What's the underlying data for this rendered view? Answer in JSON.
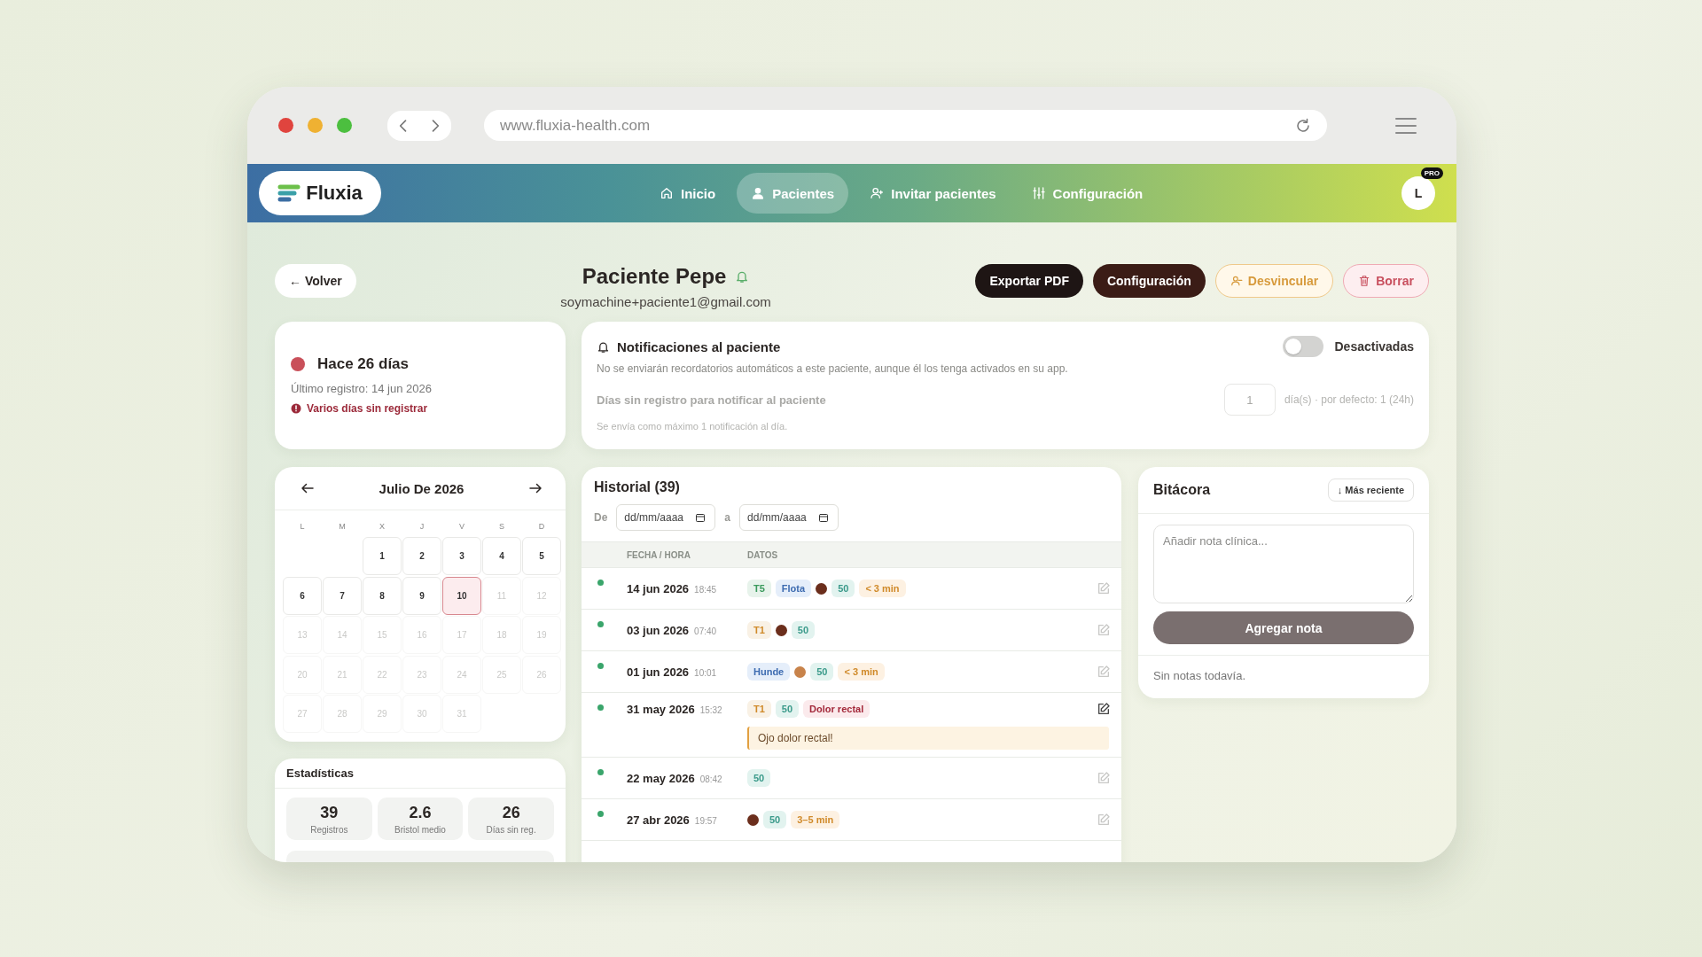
{
  "browser": {
    "url": "www.fluxia-health.com"
  },
  "nav": {
    "logo": "Fluxia",
    "items": [
      {
        "label": "Inicio",
        "selected": false
      },
      {
        "label": "Pacientes",
        "selected": true
      },
      {
        "label": "Invitar pacientes",
        "selected": false
      },
      {
        "label": "Configuración",
        "selected": false
      }
    ],
    "avatar": "L",
    "badge": "PRO"
  },
  "patient": {
    "back": "← Volver",
    "name": "Paciente Pepe",
    "email": "soymachine+paciente1@gmail.com",
    "actions": [
      {
        "label": "Exportar PDF",
        "kind": "primary"
      },
      {
        "label": "Configuración",
        "kind": "secondary"
      },
      {
        "label": "Desvincular",
        "kind": "warning"
      },
      {
        "label": "Borrar",
        "kind": "danger"
      }
    ]
  },
  "status": {
    "title": "Hace 26 días",
    "color": "#c9505a",
    "last": "Último registro: 14 jun 2026",
    "alert": "Varios días sin registrar"
  },
  "calendar": {
    "title": "Julio De 2026",
    "weekdays": [
      "L",
      "M",
      "X",
      "J",
      "V",
      "S",
      "D"
    ],
    "days": [
      {
        "kind": "blank"
      },
      {
        "kind": "blank"
      },
      {
        "kind": "day",
        "label": "1",
        "disabled": false,
        "selected": false
      },
      {
        "kind": "day",
        "label": "2",
        "disabled": false,
        "selected": false
      },
      {
        "kind": "day",
        "label": "3",
        "disabled": false,
        "selected": false
      },
      {
        "kind": "day",
        "label": "4",
        "disabled": false,
        "selected": false
      },
      {
        "kind": "day",
        "label": "5",
        "disabled": false,
        "selected": false
      },
      {
        "kind": "day",
        "label": "6",
        "disabled": false,
        "selected": false
      },
      {
        "kind": "day",
        "label": "7",
        "disabled": false,
        "selected": false
      },
      {
        "kind": "day",
        "label": "8",
        "disabled": false,
        "selected": false
      },
      {
        "kind": "day",
        "label": "9",
        "disabled": false,
        "selected": false
      },
      {
        "kind": "day",
        "label": "10",
        "disabled": false,
        "selected": true
      },
      {
        "kind": "day",
        "label": "11",
        "disabled": true,
        "selected": false
      },
      {
        "kind": "day",
        "label": "12",
        "disabled": true,
        "selected": false
      },
      {
        "kind": "day",
        "label": "13",
        "disabled": true,
        "selected": false
      },
      {
        "kind": "day",
        "label": "14",
        "disabled": true,
        "selected": false
      },
      {
        "kind": "day",
        "label": "15",
        "disabled": true,
        "selected": false
      },
      {
        "kind": "day",
        "label": "16",
        "disabled": true,
        "selected": false
      },
      {
        "kind": "day",
        "label": "17",
        "disabled": true,
        "selected": false
      },
      {
        "kind": "day",
        "label": "18",
        "disabled": true,
        "selected": false
      },
      {
        "kind": "day",
        "label": "19",
        "disabled": true,
        "selected": false
      },
      {
        "kind": "day",
        "label": "20",
        "disabled": true,
        "selected": false
      },
      {
        "kind": "day",
        "label": "21",
        "disabled": true,
        "selected": false
      },
      {
        "kind": "day",
        "label": "22",
        "disabled": true,
        "selected": false
      },
      {
        "kind": "day",
        "label": "23",
        "disabled": true,
        "selected": false
      },
      {
        "kind": "day",
        "label": "24",
        "disabled": true,
        "selected": false
      },
      {
        "kind": "day",
        "label": "25",
        "disabled": true,
        "selected": false
      },
      {
        "kind": "day",
        "label": "26",
        "disabled": true,
        "selected": false
      },
      {
        "kind": "day",
        "label": "27",
        "disabled": true,
        "selected": false
      },
      {
        "kind": "day",
        "label": "28",
        "disabled": true,
        "selected": false
      },
      {
        "kind": "day",
        "label": "29",
        "disabled": true,
        "selected": false
      },
      {
        "kind": "day",
        "label": "30",
        "disabled": true,
        "selected": false
      },
      {
        "kind": "day",
        "label": "31",
        "disabled": true,
        "selected": false
      }
    ]
  },
  "stats": {
    "title": "Estadísticas",
    "items": [
      {
        "value": "39",
        "label": "Registros"
      },
      {
        "value": "2.6",
        "label": "Bristol medio"
      },
      {
        "value": "26",
        "label": "Días sin reg."
      }
    ]
  },
  "notifications": {
    "title": "Notificaciones al paciente",
    "toggle_label": "Desactivadas",
    "on": false,
    "description": "No se enviarán recordatorios automáticos a este paciente, aunque él los tenga activados en su app.",
    "disabled": true,
    "setting_label": "Días sin registro para notificar al paciente",
    "days_value": "1",
    "unit_hint": "día(s) · por defecto: 1 (24h)",
    "footnote": "Se envía como máximo 1 notificación al día."
  },
  "history": {
    "title": "Historial (39)",
    "from_label": "De",
    "from_placeholder": "dd/mm/aaaa",
    "to_label": "a",
    "to_placeholder": "dd/mm/aaaa",
    "columns": [
      "FECHA / HORA",
      "DATOS"
    ],
    "rows": [
      {
        "date": "14 jun 2026",
        "time": "18:45",
        "edit_active": false,
        "tags": [
          {
            "kind": "type",
            "text": "T5",
            "color": "#3a9a5c"
          },
          {
            "kind": "float",
            "text": "Flota"
          },
          {
            "kind": "dot",
            "color": "#6b2e1c"
          },
          {
            "kind": "number",
            "text": "50"
          },
          {
            "kind": "time",
            "text": "< 3 min"
          }
        ]
      },
      {
        "date": "03 jun 2026",
        "time": "07:40",
        "edit_active": false,
        "tags": [
          {
            "kind": "type",
            "text": "T1",
            "color": "#d08a2a"
          },
          {
            "kind": "dot",
            "color": "#6b2e1c"
          },
          {
            "kind": "number",
            "text": "50"
          }
        ]
      },
      {
        "date": "01 jun 2026",
        "time": "10:01",
        "edit_active": false,
        "tags": [
          {
            "kind": "float",
            "text": "Hunde"
          },
          {
            "kind": "dot",
            "color": "#c8834a"
          },
          {
            "kind": "number",
            "text": "50"
          },
          {
            "kind": "time",
            "text": "< 3 min"
          }
        ]
      },
      {
        "date": "31 may 2026",
        "time": "15:32",
        "edit_active": true,
        "note": "Ojo dolor rectal!",
        "tags": [
          {
            "kind": "type",
            "text": "T1",
            "color": "#d08a2a"
          },
          {
            "kind": "number",
            "text": "50"
          },
          {
            "kind": "symptom",
            "text": "Dolor rectal"
          }
        ]
      },
      {
        "date": "22 may 2026",
        "time": "08:42",
        "edit_active": false,
        "tags": [
          {
            "kind": "number",
            "text": "50"
          }
        ]
      },
      {
        "date": "27 abr 2026",
        "time": "19:57",
        "edit_active": false,
        "tags": [
          {
            "kind": "dot",
            "color": "#6b2e1c"
          },
          {
            "kind": "number",
            "text": "50"
          },
          {
            "kind": "time",
            "text": "3–5 min"
          }
        ]
      }
    ]
  },
  "log": {
    "title": "Bitácora",
    "sort": "↓ Más reciente",
    "placeholder": "Añadir nota clínica...",
    "submit": "Agregar nota",
    "empty": "Sin notas todavía."
  }
}
